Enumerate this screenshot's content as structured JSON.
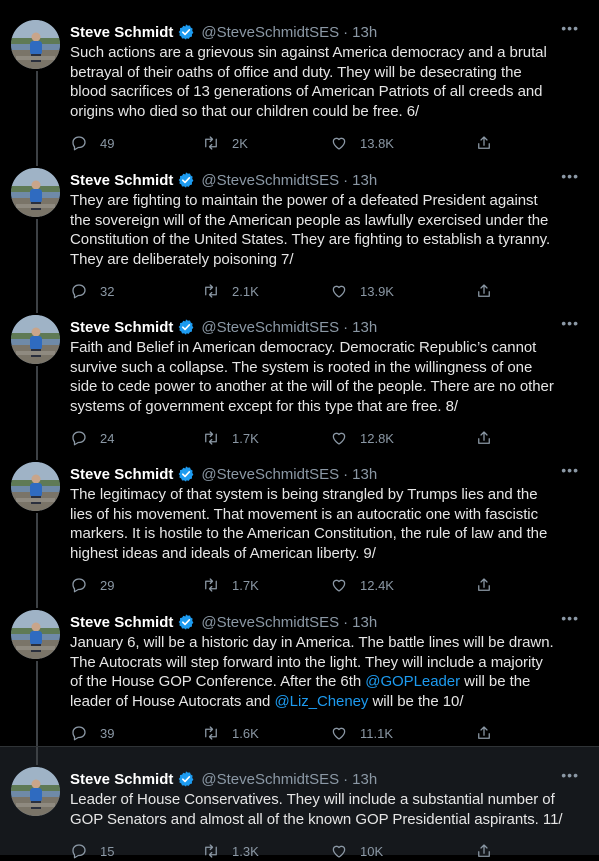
{
  "author": {
    "name": "Steve Schmidt",
    "handle": "@SteveSchmidtSES",
    "separator": "·",
    "more": "•••"
  },
  "colors": {
    "background": "#000000",
    "mention": "#1d9bf0",
    "muted": "#8b98a5",
    "verified": "#1d9bf0"
  },
  "tweets": [
    {
      "time": "13h",
      "lines": [
        "Such actions are a grievous sin against America democracy and a brutal",
        "betrayal of their oaths of office and duty. They will be desecrating the",
        "blood sacrifices of 13 generations of American Patriots of all creeds and",
        "origins who died so that our children could be free. 6/"
      ],
      "replies": "49",
      "retweets": "2K",
      "likes": "13.8K"
    },
    {
      "time": "13h",
      "lines": [
        "They are fighting to maintain the power of a defeated President against",
        "the sovereign will of the American people as lawfully exercised under the",
        "Constitution of the United States. They are fighting to establish a tyranny.",
        "They are deliberately poisoning 7/"
      ],
      "replies": "32",
      "retweets": "2.1K",
      "likes": "13.9K"
    },
    {
      "time": "13h",
      "lines": [
        "Faith and Belief in American democracy.  Democratic Republic’s cannot",
        "survive such a collapse. The system is rooted in the willingness of one",
        "side to cede power to another at the will of the people. There are no other",
        "systems of government except for this type that are free.  8/"
      ],
      "replies": "24",
      "retweets": "1.7K",
      "likes": "12.8K"
    },
    {
      "time": "13h",
      "lines": [
        "The legitimacy of that system is being strangled by Trumps lies and the",
        "lies of his movement. That movement is an autocratic one with fascistic",
        "markers. It is hostile to the American Constitution, the rule of law and the",
        "highest ideas and ideals of American liberty. 9/"
      ],
      "replies": "29",
      "retweets": "1.7K",
      "likes": "12.4K"
    },
    {
      "time": "13h",
      "lines": [
        "January 6, will be a historic day in America. The battle lines will be drawn.",
        "The Autocrats will step forward into the light. They will include a majority",
        "of the House GOP Conference.  After the 6th ",
        "leader of House Autocrats and "
      ],
      "mention1": "@GOPLeader",
      "after1": " will be the",
      "mention2": "@Liz_Cheney",
      "after2": " will be the 10/",
      "replies": "39",
      "retweets": "1.6K",
      "likes": "11.1K"
    },
    {
      "time": "13h",
      "lines": [
        "Leader of House Conservatives. They will include a substantial number of",
        "GOP Senators and almost all of the known GOP Presidential aspirants. 11/"
      ],
      "replies": "15",
      "retweets": "1.3K",
      "likes": "10K"
    }
  ]
}
